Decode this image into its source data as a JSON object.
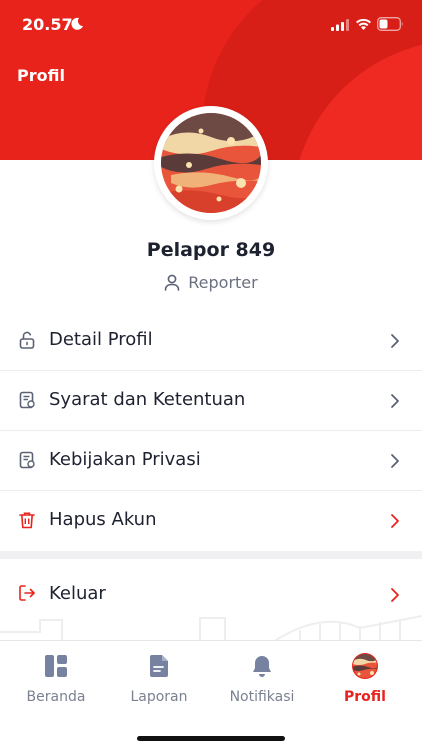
{
  "status_bar": {
    "time": "20.57",
    "icons": [
      "moon-icon",
      "signal-icon",
      "wifi-icon",
      "battery-icon"
    ]
  },
  "header": {
    "title": "Profil",
    "color": "#e8231c"
  },
  "profile": {
    "name": "Pelapor 849",
    "role": "Reporter",
    "avatar": "avatar-image"
  },
  "menu": {
    "items": [
      {
        "label": "Detail Profil",
        "icon": "lock-open-icon"
      },
      {
        "label": "Syarat dan Ketentuan",
        "icon": "document-icon"
      },
      {
        "label": "Kebijakan Privasi",
        "icon": "document-icon"
      },
      {
        "label": "Hapus Akun",
        "icon": "trash-icon"
      }
    ],
    "logout": {
      "label": "Keluar",
      "icon": "logout-icon"
    }
  },
  "bottom_nav": {
    "items": [
      {
        "label": "Beranda",
        "icon": "dashboard-icon"
      },
      {
        "label": "Laporan",
        "icon": "report-icon"
      },
      {
        "label": "Notifikasi",
        "icon": "bell-icon"
      },
      {
        "label": "Profil",
        "icon": "avatar-icon"
      }
    ],
    "active": "Profil"
  },
  "colors": {
    "accent": "#e8231c",
    "icon_gray": "#5b6274",
    "nav_inactive": "#7c8192"
  }
}
